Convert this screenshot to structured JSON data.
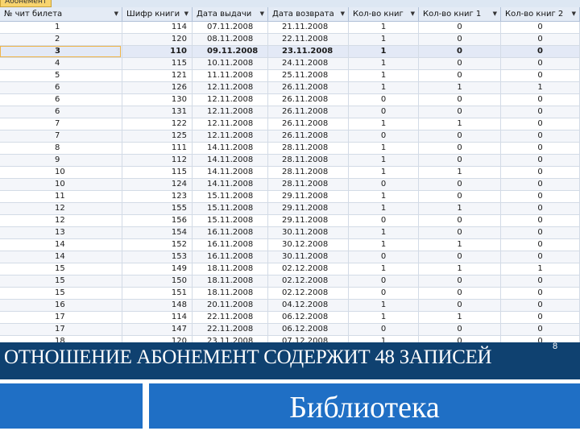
{
  "tab": {
    "label": "Абонемент"
  },
  "columns": [
    "№ чит билета",
    "Шифр книги",
    "Дата выдачи",
    "Дата возврата",
    "Кол-во книг",
    "Кол-во книг 1",
    "Кол-во книг 2"
  ],
  "rows": [
    [
      "1",
      "114",
      "07.11.2008",
      "21.11.2008",
      "1",
      "0",
      "0"
    ],
    [
      "2",
      "120",
      "08.11.2008",
      "22.11.2008",
      "1",
      "0",
      "0"
    ],
    [
      "3",
      "110",
      "09.11.2008",
      "23.11.2008",
      "1",
      "0",
      "0"
    ],
    [
      "4",
      "115",
      "10.11.2008",
      "24.11.2008",
      "1",
      "0",
      "0"
    ],
    [
      "5",
      "121",
      "11.11.2008",
      "25.11.2008",
      "1",
      "0",
      "0"
    ],
    [
      "6",
      "126",
      "12.11.2008",
      "26.11.2008",
      "1",
      "1",
      "1"
    ],
    [
      "6",
      "130",
      "12.11.2008",
      "26.11.2008",
      "0",
      "0",
      "0"
    ],
    [
      "6",
      "131",
      "12.11.2008",
      "26.11.2008",
      "0",
      "0",
      "0"
    ],
    [
      "7",
      "122",
      "12.11.2008",
      "26.11.2008",
      "1",
      "1",
      "0"
    ],
    [
      "7",
      "125",
      "12.11.2008",
      "26.11.2008",
      "0",
      "0",
      "0"
    ],
    [
      "8",
      "111",
      "14.11.2008",
      "28.11.2008",
      "1",
      "0",
      "0"
    ],
    [
      "9",
      "112",
      "14.11.2008",
      "28.11.2008",
      "1",
      "0",
      "0"
    ],
    [
      "10",
      "115",
      "14.11.2008",
      "28.11.2008",
      "1",
      "1",
      "0"
    ],
    [
      "10",
      "124",
      "14.11.2008",
      "28.11.2008",
      "0",
      "0",
      "0"
    ],
    [
      "11",
      "123",
      "15.11.2008",
      "29.11.2008",
      "1",
      "0",
      "0"
    ],
    [
      "12",
      "155",
      "15.11.2008",
      "29.11.2008",
      "1",
      "1",
      "0"
    ],
    [
      "12",
      "156",
      "15.11.2008",
      "29.11.2008",
      "0",
      "0",
      "0"
    ],
    [
      "13",
      "154",
      "16.11.2008",
      "30.11.2008",
      "1",
      "0",
      "0"
    ],
    [
      "14",
      "152",
      "16.11.2008",
      "30.12.2008",
      "1",
      "1",
      "0"
    ],
    [
      "14",
      "153",
      "16.11.2008",
      "30.11.2008",
      "0",
      "0",
      "0"
    ],
    [
      "15",
      "149",
      "18.11.2008",
      "02.12.2008",
      "1",
      "1",
      "1"
    ],
    [
      "15",
      "150",
      "18.11.2008",
      "02.12.2008",
      "0",
      "0",
      "0"
    ],
    [
      "15",
      "151",
      "18.11.2008",
      "02.12.2008",
      "0",
      "0",
      "0"
    ],
    [
      "16",
      "148",
      "20.11.2008",
      "04.12.2008",
      "1",
      "0",
      "0"
    ],
    [
      "17",
      "114",
      "22.11.2008",
      "06.12.2008",
      "1",
      "1",
      "0"
    ],
    [
      "17",
      "147",
      "22.11.2008",
      "06.12.2008",
      "0",
      "0",
      "0"
    ],
    [
      "18",
      "120",
      "23.11.2008",
      "07.12.2008",
      "1",
      "0",
      "0"
    ]
  ],
  "selected_row_index": 2,
  "slide": {
    "title": "ОТНОШЕНИЕ АБОНЕМЕНТ СОДЕРЖИТ 48 ЗАПИСЕЙ",
    "page_number": "8",
    "footer_text": "Библиотека"
  }
}
